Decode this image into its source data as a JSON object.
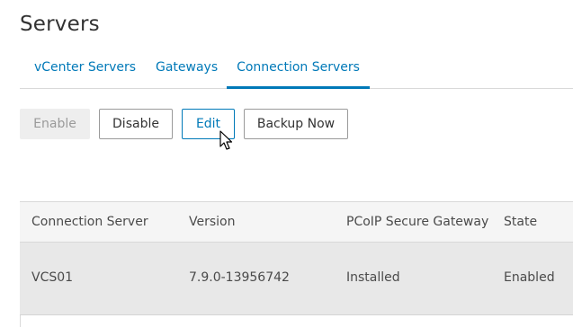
{
  "page": {
    "title": "Servers"
  },
  "tabs": [
    {
      "label": "vCenter Servers",
      "active": false
    },
    {
      "label": "Gateways",
      "active": false
    },
    {
      "label": "Connection Servers",
      "active": true
    }
  ],
  "toolbar": {
    "enable_label": "Enable",
    "disable_label": "Disable",
    "edit_label": "Edit",
    "backup_label": "Backup Now"
  },
  "table": {
    "columns": [
      "Connection Server",
      "Version",
      "PCoIP Secure Gateway",
      "State"
    ],
    "rows": [
      [
        "VCS01",
        "7.9.0-13956742",
        "Installed",
        "Enabled"
      ]
    ]
  },
  "colors": {
    "accent": "#0079b8",
    "disabled_bg": "#eeeeee",
    "selected_row": "#e8e8e8"
  },
  "icons": {
    "cursor": "mouse-pointer-icon"
  }
}
